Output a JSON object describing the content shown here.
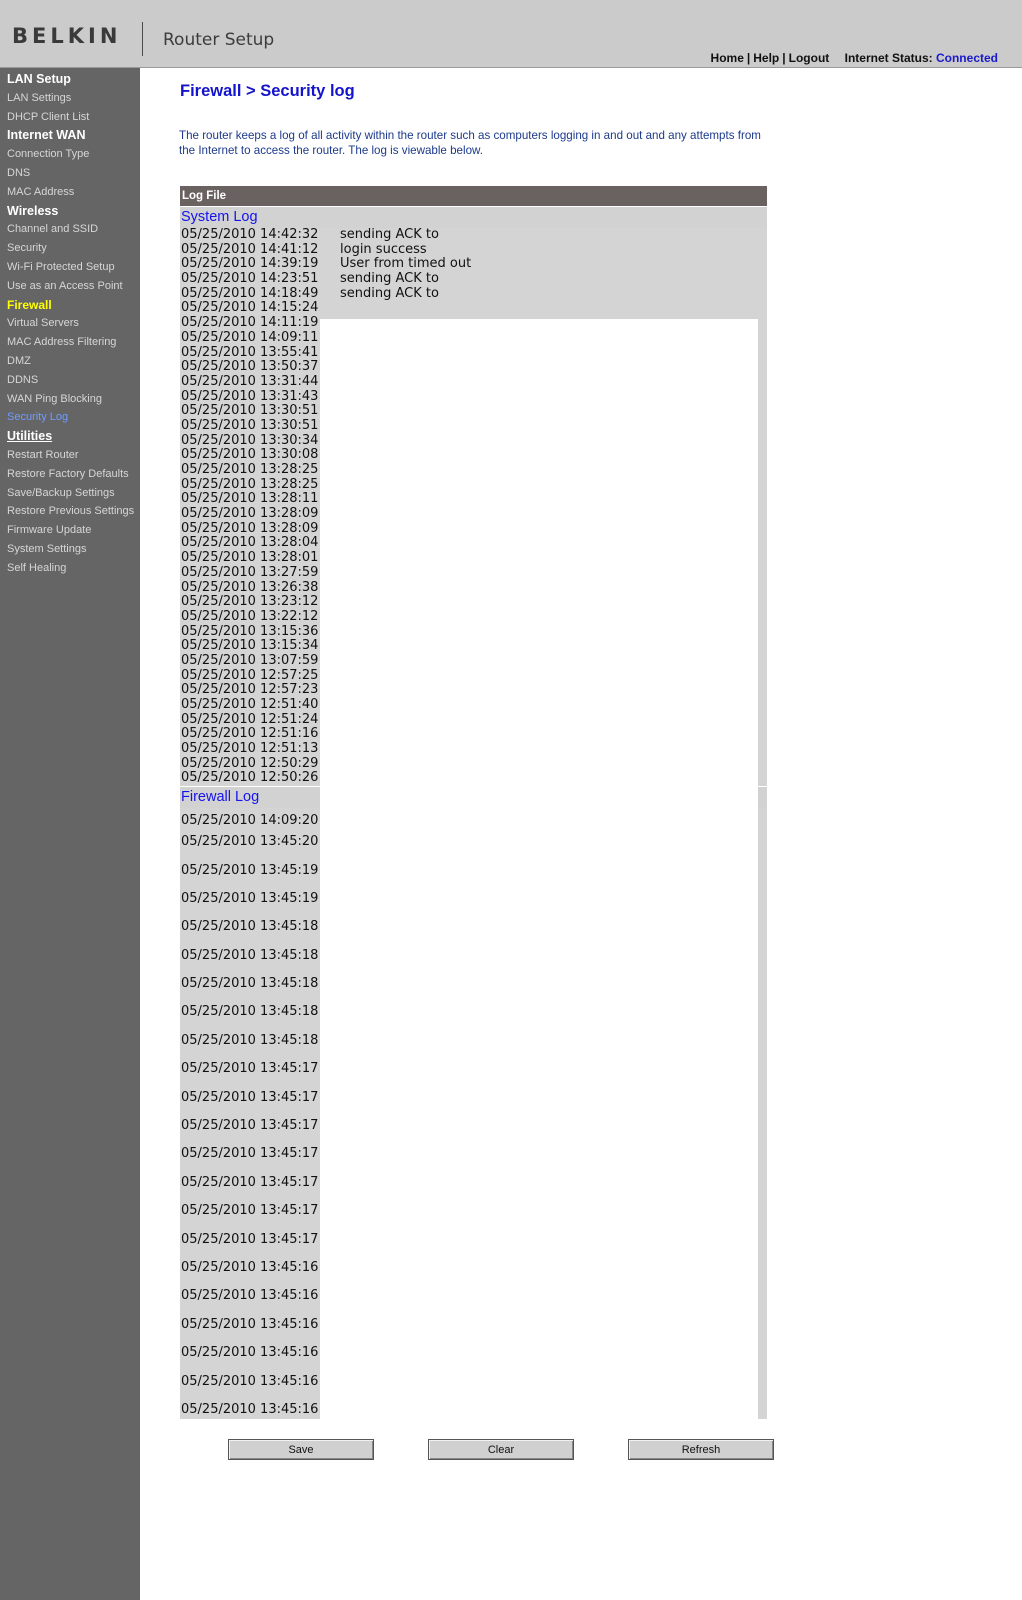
{
  "header": {
    "logo": "BELKIN",
    "app_title": "Router Setup",
    "links": [
      "Home",
      "Help",
      "Logout"
    ],
    "status_label": "Internet Status:",
    "status_value": "Connected"
  },
  "sidebar": [
    {
      "type": "section",
      "label": "LAN Setup"
    },
    {
      "type": "item",
      "label": "LAN Settings"
    },
    {
      "type": "item",
      "label": "DHCP Client List"
    },
    {
      "type": "section",
      "label": "Internet WAN"
    },
    {
      "type": "item",
      "label": "Connection Type"
    },
    {
      "type": "item",
      "label": "DNS"
    },
    {
      "type": "item",
      "label": "MAC Address"
    },
    {
      "type": "section",
      "label": "Wireless"
    },
    {
      "type": "item",
      "label": "Channel and SSID"
    },
    {
      "type": "item",
      "label": "Security"
    },
    {
      "type": "item",
      "label": "Wi-Fi Protected Setup"
    },
    {
      "type": "item",
      "label": "Use as an Access Point"
    },
    {
      "type": "highlight",
      "label": "Firewall"
    },
    {
      "type": "item",
      "label": "Virtual Servers"
    },
    {
      "type": "item",
      "label": "MAC Address Filtering"
    },
    {
      "type": "item",
      "label": "DMZ"
    },
    {
      "type": "item",
      "label": "DDNS"
    },
    {
      "type": "item",
      "label": "WAN Ping Blocking"
    },
    {
      "type": "active",
      "label": "Security Log"
    },
    {
      "type": "section-link",
      "label": "Utilities"
    },
    {
      "type": "item",
      "label": "Restart Router"
    },
    {
      "type": "item",
      "label": "Restore Factory Defaults"
    },
    {
      "type": "item",
      "label": "Save/Backup Settings"
    },
    {
      "type": "item",
      "label": "Restore Previous Settings"
    },
    {
      "type": "item",
      "label": "Firmware Update"
    },
    {
      "type": "item",
      "label": "System Settings"
    },
    {
      "type": "item",
      "label": "Self Healing"
    }
  ],
  "main": {
    "title": "Firewall > Security log",
    "intro": "The router keeps a log of all activity within the router such as computers logging in and out and any attempts from the Internet to access the router. The log is viewable below.",
    "log_header": "Log File",
    "system_log_title": "System Log",
    "firewall_log_title": "Firewall Log",
    "system_log": [
      {
        "time": "05/25/2010 14:42:32",
        "msg": "sending ACK to"
      },
      {
        "time": "05/25/2010 14:41:12",
        "msg": "login success"
      },
      {
        "time": "05/25/2010 14:39:19",
        "msg": "User from              timed out"
      },
      {
        "time": "05/25/2010 14:23:51",
        "msg": "sending ACK to"
      },
      {
        "time": "05/25/2010 14:18:49",
        "msg": "sending ACK to"
      },
      {
        "time": "05/25/2010 14:15:24",
        "msg": ""
      },
      {
        "time": "05/25/2010 14:11:19",
        "msg": ""
      },
      {
        "time": "05/25/2010 14:09:11",
        "msg": ""
      },
      {
        "time": "05/25/2010 13:55:41",
        "msg": ""
      },
      {
        "time": "05/25/2010 13:50:37",
        "msg": ""
      },
      {
        "time": "05/25/2010 13:31:44",
        "msg": ""
      },
      {
        "time": "05/25/2010 13:31:43",
        "msg": ""
      },
      {
        "time": "05/25/2010 13:30:51",
        "msg": ""
      },
      {
        "time": "05/25/2010 13:30:51",
        "msg": ""
      },
      {
        "time": "05/25/2010 13:30:34",
        "msg": ""
      },
      {
        "time": "05/25/2010 13:30:08",
        "msg": ""
      },
      {
        "time": "05/25/2010 13:28:25",
        "msg": ""
      },
      {
        "time": "05/25/2010 13:28:25",
        "msg": ""
      },
      {
        "time": "05/25/2010 13:28:11",
        "msg": ""
      },
      {
        "time": "05/25/2010 13:28:09",
        "msg": ""
      },
      {
        "time": "05/25/2010 13:28:09",
        "msg": ""
      },
      {
        "time": "05/25/2010 13:28:04",
        "msg": ""
      },
      {
        "time": "05/25/2010 13:28:01",
        "msg": ""
      },
      {
        "time": "05/25/2010 13:27:59",
        "msg": ""
      },
      {
        "time": "05/25/2010 13:26:38",
        "msg": ""
      },
      {
        "time": "05/25/2010 13:23:12",
        "msg": ""
      },
      {
        "time": "05/25/2010 13:22:12",
        "msg": ""
      },
      {
        "time": "05/25/2010 13:15:36",
        "msg": ""
      },
      {
        "time": "05/25/2010 13:15:34",
        "msg": ""
      },
      {
        "time": "05/25/2010 13:07:59",
        "msg": ""
      },
      {
        "time": "05/25/2010 12:57:25",
        "msg": ""
      },
      {
        "time": "05/25/2010 12:57:23",
        "msg": ""
      },
      {
        "time": "05/25/2010 12:51:40",
        "msg": ""
      },
      {
        "time": "05/25/2010 12:51:24",
        "msg": ""
      },
      {
        "time": "05/25/2010 12:51:16",
        "msg": ""
      },
      {
        "time": "05/25/2010 12:51:13",
        "msg": ""
      },
      {
        "time": "05/25/2010 12:50:29",
        "msg": ""
      },
      {
        "time": "05/25/2010 12:50:26",
        "msg": ""
      }
    ],
    "firewall_log": [
      "05/25/2010 14:09:20",
      "05/25/2010 13:45:20",
      "05/25/2010 13:45:19",
      "05/25/2010 13:45:19",
      "05/25/2010 13:45:18",
      "05/25/2010 13:45:18",
      "05/25/2010 13:45:18",
      "05/25/2010 13:45:18",
      "05/25/2010 13:45:18",
      "05/25/2010 13:45:17",
      "05/25/2010 13:45:17",
      "05/25/2010 13:45:17",
      "05/25/2010 13:45:17",
      "05/25/2010 13:45:17",
      "05/25/2010 13:45:17",
      "05/25/2010 13:45:17",
      "05/25/2010 13:45:16",
      "05/25/2010 13:45:16",
      "05/25/2010 13:45:16",
      "05/25/2010 13:45:16",
      "05/25/2010 13:45:16",
      "05/25/2010 13:45:16"
    ]
  },
  "buttons": {
    "save": "Save",
    "clear": "Clear",
    "refresh": "Refresh"
  }
}
